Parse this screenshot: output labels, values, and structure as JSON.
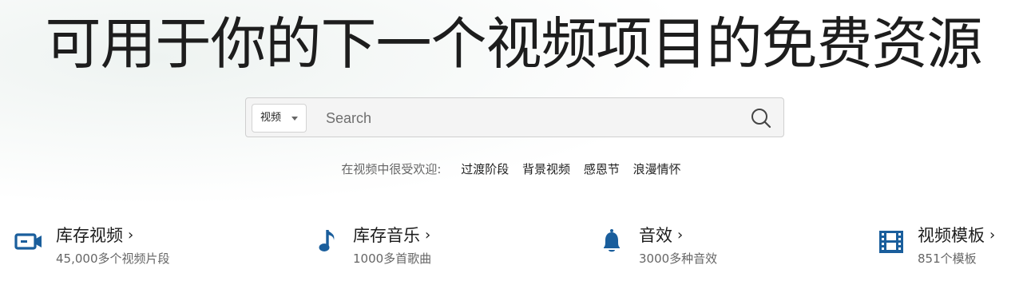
{
  "hero": {
    "title": "可用于你的下一个视频项目的免费资源"
  },
  "search": {
    "type_selected": "视频",
    "placeholder": "Search"
  },
  "popular": {
    "label": "在视频中很受欢迎:",
    "tags": [
      "过渡阶段",
      "背景视频",
      "感恩节",
      "浪漫情怀"
    ]
  },
  "categories": [
    {
      "title": "库存视频",
      "subtitle": "45,000多个视频片段",
      "icon": "video-camera-icon"
    },
    {
      "title": "库存音乐",
      "subtitle": "1000多首歌曲",
      "icon": "music-note-icon"
    },
    {
      "title": "音效",
      "subtitle": "3000多种音效",
      "icon": "bell-icon"
    },
    {
      "title": "视频模板",
      "subtitle": "851个模板",
      "icon": "film-strip-icon"
    }
  ],
  "colors": {
    "icon_blue": "#1a5e9c",
    "text_dark": "#1d1d1d",
    "text_muted": "#666666"
  }
}
